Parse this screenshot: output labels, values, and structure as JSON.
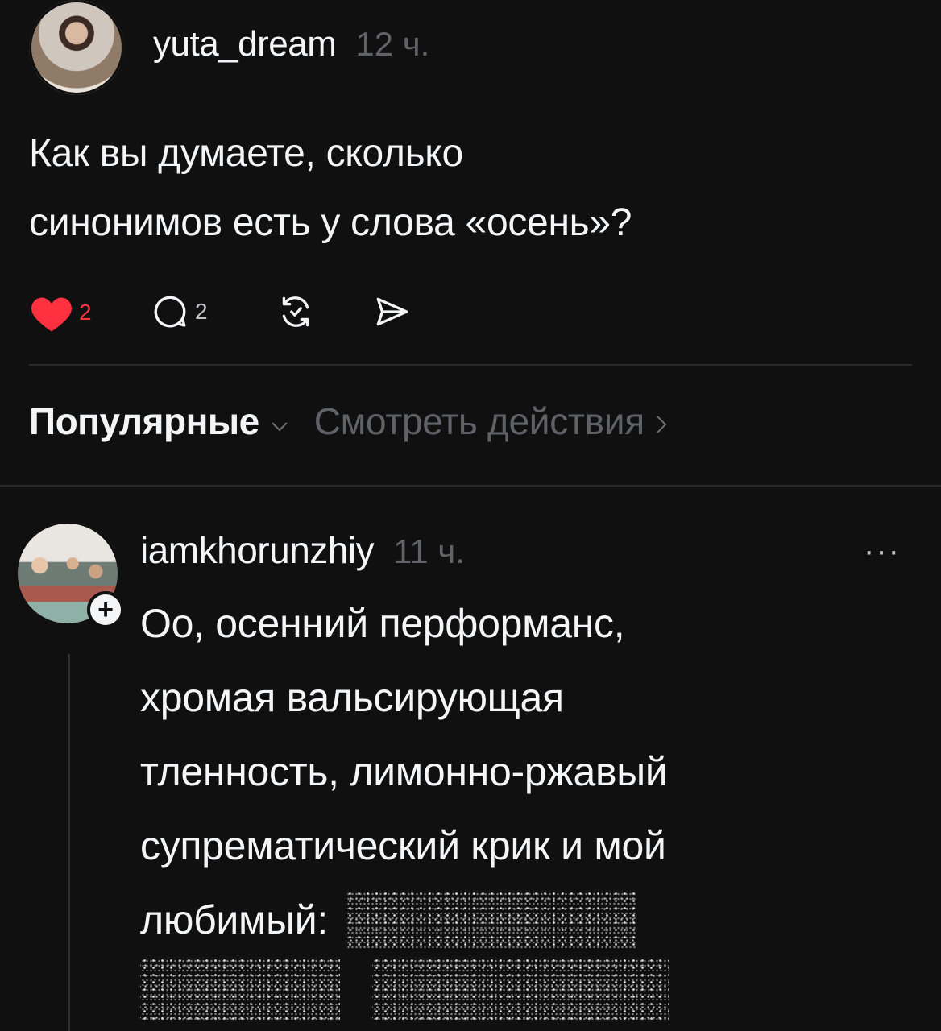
{
  "post": {
    "author": "yuta_dream",
    "time": "12 ч.",
    "text_line1": "Как вы думаете, сколько",
    "text_line2": "синонимов есть у слова «осень»?",
    "likes": "2",
    "comments": "2",
    "colors": {
      "heart": "#ff3040",
      "text": "#f3f5f7",
      "muted": "#5f6266",
      "bg": "#101010"
    }
  },
  "sort_bar": {
    "sort_label": "Популярные",
    "view_activity_label": "Смотреть действия"
  },
  "reply": {
    "author": "iamkhorunzhiy",
    "time": "11 ч.",
    "more": "···",
    "line1": "Оо, осенний перформанс,",
    "line2": "хромая вальсирующая",
    "line3": "тленность, лимонно-ржавый",
    "line4": "супрематический крик и мой",
    "line5": "любимый:"
  },
  "icons": [
    "avatar",
    "heart-icon",
    "comment-icon",
    "repost-icon",
    "share-icon",
    "chevron-down-icon",
    "chevron-right-icon",
    "more-icon",
    "plus-icon"
  ]
}
